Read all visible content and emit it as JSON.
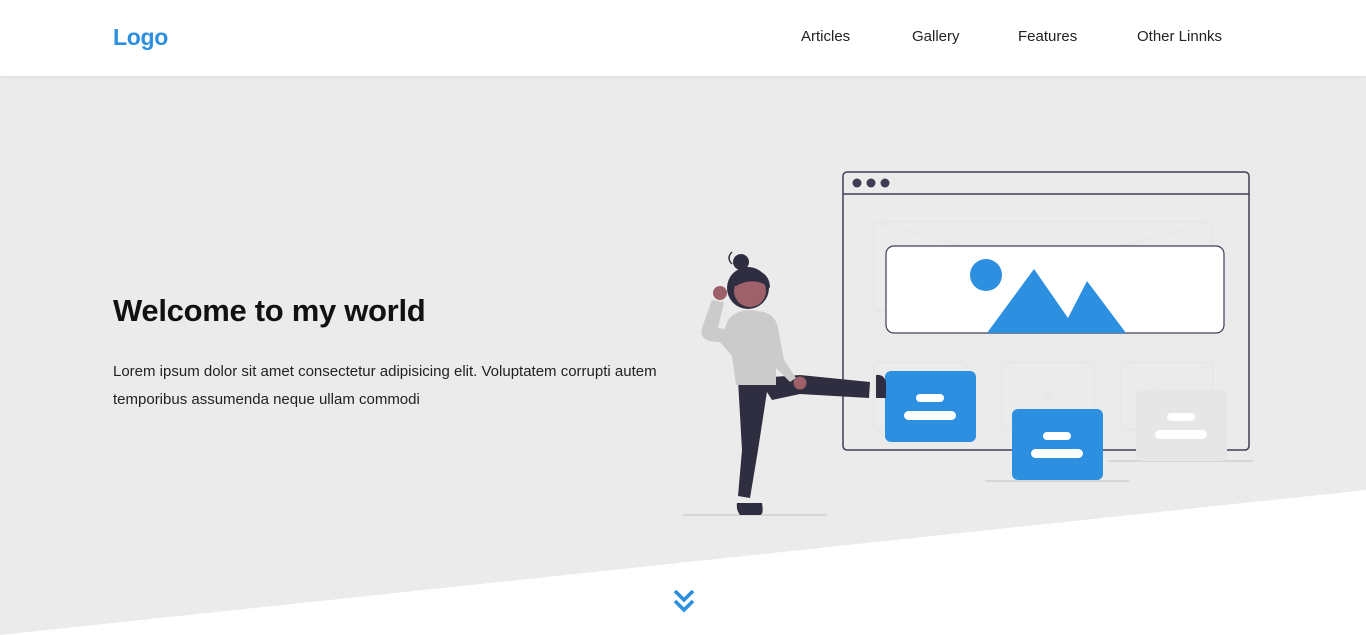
{
  "header": {
    "logo": "Logo",
    "nav": [
      {
        "label": "Articles"
      },
      {
        "label": "Gallery"
      },
      {
        "label": "Features"
      },
      {
        "label": "Other Linnks"
      }
    ]
  },
  "hero": {
    "title": "Welcome to my world",
    "text": "Lorem ipsum dolor sit amet consectetur adipisicing elit. Voluptatem corrupti autem temporibus assumenda neque ullam commodi"
  },
  "colors": {
    "accent": "#2c8fe0",
    "hero_bg": "#ebebeb",
    "ink": "#3f3d56"
  },
  "icons": {
    "scroll": "double-chevron-down-icon"
  }
}
